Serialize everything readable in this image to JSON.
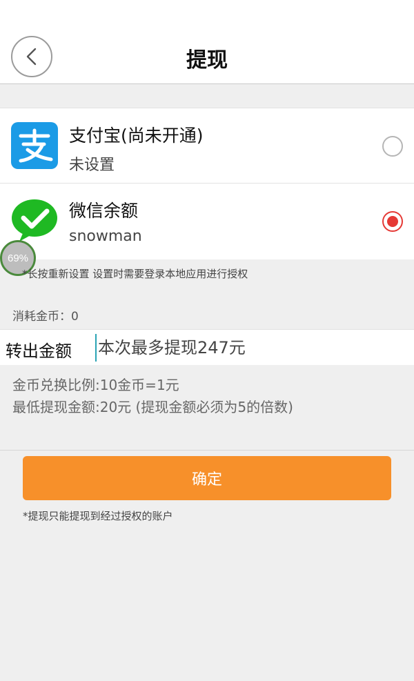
{
  "header": {
    "title": "提现"
  },
  "payment_options": [
    {
      "name": "支付宝(尚未开通)",
      "sub": "未设置",
      "selected": false,
      "icon": "alipay-icon"
    },
    {
      "name": "微信余额",
      "sub": "snowman",
      "selected": true,
      "icon": "wechat-icon"
    }
  ],
  "progress_badge": {
    "value": 69,
    "label": "69%"
  },
  "notes": {
    "auth": "*长按重新设置 设置时需要登录本地应用进行授权",
    "coins": "消耗金币：0",
    "rate": "金币兑换比例:10金币=1元",
    "min": "最低提现金额:20元 (提现金额必须为5的倍数)",
    "footer": "*提现只能提现到经过授权的账户"
  },
  "amount": {
    "label": "转出金额",
    "placeholder": "本次最多提现247元",
    "value": ""
  },
  "confirm": {
    "label": "确定"
  },
  "colors": {
    "accent": "#f7902a",
    "radio_selected": "#e53935",
    "alipay_blue": "#1b9be6",
    "wechat_green": "#1fb923"
  }
}
